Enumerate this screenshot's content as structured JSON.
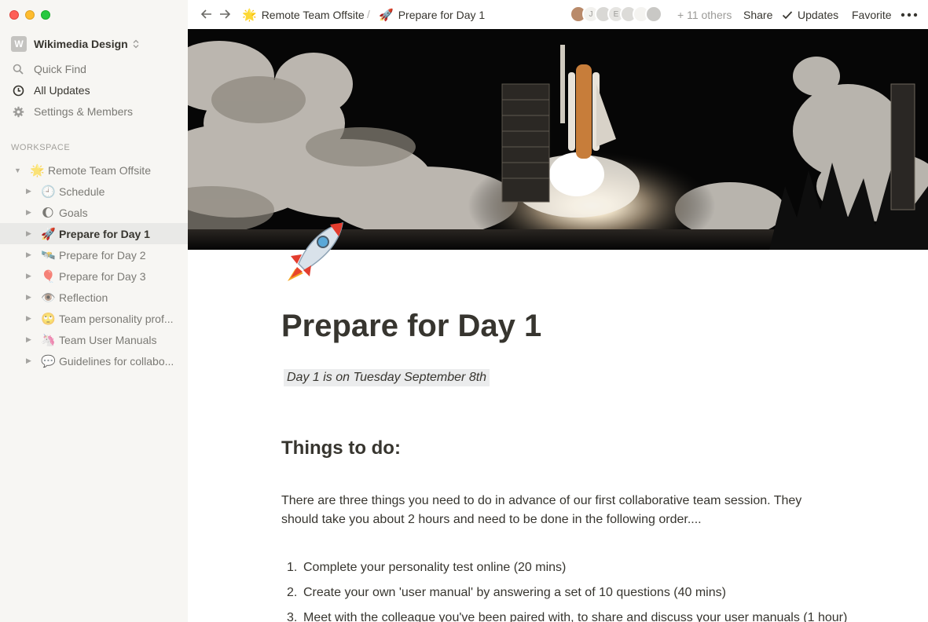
{
  "sidebar": {
    "workspace": {
      "logo_letter": "W",
      "name": "Wikimedia Design"
    },
    "nav": [
      {
        "label": "Quick Find",
        "icon": "search-icon"
      },
      {
        "label": "All Updates",
        "icon": "clock-icon"
      },
      {
        "label": "Settings & Members",
        "icon": "gear-icon"
      }
    ],
    "section_label": "WORKSPACE",
    "tree": [
      {
        "emoji": "🌟",
        "label": "Remote Team Offsite",
        "expanded": true,
        "level": 0
      },
      {
        "emoji": "🕘",
        "label": "Schedule",
        "level": 1
      },
      {
        "emoji": "🌔",
        "label": "Goals",
        "level": 1
      },
      {
        "emoji": "🚀",
        "label": "Prepare for Day 1",
        "level": 1,
        "active": true
      },
      {
        "emoji": "🛰️",
        "label": "Prepare for Day 2",
        "level": 1
      },
      {
        "emoji": "🎈",
        "label": "Prepare for Day 3",
        "level": 1
      },
      {
        "emoji": "👁️",
        "label": "Reflection",
        "level": 1
      },
      {
        "emoji": "🙄",
        "label": "Team personality prof...",
        "level": 1
      },
      {
        "emoji": "🦄",
        "label": "Team User Manuals",
        "level": 1
      },
      {
        "emoji": "💬",
        "label": "Guidelines for collabo...",
        "level": 1
      }
    ]
  },
  "topbar": {
    "breadcrumb": [
      {
        "emoji": "🌟",
        "label": "Remote Team Offsite"
      },
      {
        "emoji": "🚀",
        "label": "Prepare for Day 1"
      }
    ],
    "separator": "/",
    "avatar_letters": [
      "",
      "J",
      "",
      "E",
      "",
      "",
      ""
    ],
    "others": "+ 11 others",
    "share": "Share",
    "updates": "Updates",
    "favorite": "Favorite"
  },
  "page": {
    "icon": "rocket-icon",
    "title": "Prepare for Day 1",
    "callout": "Day 1 is on Tuesday September 8th",
    "heading": "Things to do:",
    "paragraph": "There are three things you need to do in advance of our first collaborative team session.  They should take you about 2 hours and need to be done in the following order....",
    "list": [
      {
        "num": "1.",
        "text": "Complete your personality test online (20 mins)"
      },
      {
        "num": "2.",
        "text": "Create your own 'user manual' by answering a set of 10 questions (40 mins)"
      },
      {
        "num": "3.",
        "text": "Meet with the colleague you've been paired with, to share and discuss your user manuals (1 hour)"
      }
    ]
  },
  "colors": {
    "sidebar_bg": "#f7f6f3",
    "active_row": "#e9e9e7",
    "text": "#37352f",
    "muted": "#9b9a97",
    "callout_bg": "#ebeced"
  }
}
